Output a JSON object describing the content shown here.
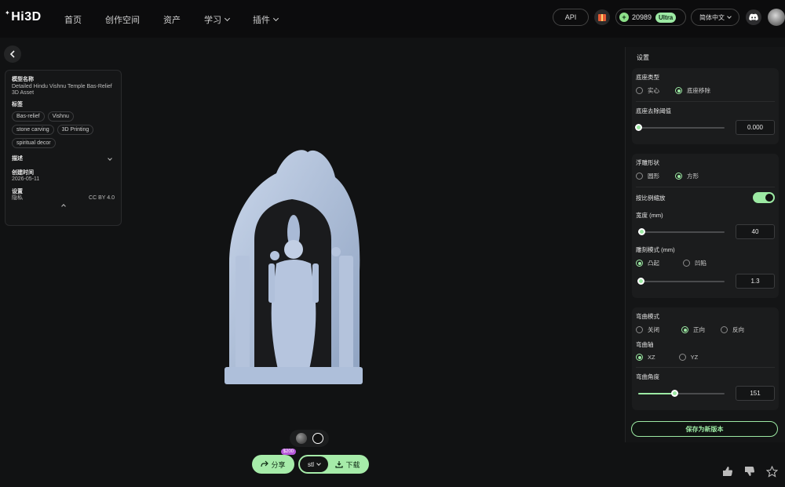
{
  "app": {
    "logo": "Hi3D"
  },
  "nav": [
    {
      "label": "首页",
      "has_dropdown": false
    },
    {
      "label": "创作空间",
      "has_dropdown": false
    },
    {
      "label": "资产",
      "has_dropdown": false
    },
    {
      "label": "学习",
      "has_dropdown": true
    },
    {
      "label": "插件",
      "has_dropdown": true
    }
  ],
  "header": {
    "api_label": "API",
    "credits": "20989",
    "plan": "Ultra",
    "language": "简体中文"
  },
  "model_info": {
    "name_label": "模型名称",
    "name": "Detailed Hindu Vishnu Temple Bas-Relief 3D Asset",
    "tags_label": "标签",
    "tags": [
      "Bas-relief",
      "Vishnu",
      "stone carving",
      "3D Printing",
      "spiritual decor"
    ],
    "desc_label": "描述",
    "created_label": "创建时间",
    "created": "2026-05-11",
    "settings_label": "设置",
    "privacy_label": "隐私",
    "license": "CC BY 4.0"
  },
  "viewer": {
    "share_label": "分享",
    "share_badge": "$200",
    "format": "stl",
    "download_label": "下载"
  },
  "settings": {
    "title": "设置",
    "base_type": {
      "label": "底座类型",
      "options": [
        "实心",
        "底座移除"
      ],
      "selected": 1
    },
    "base_threshold": {
      "label": "底座去除阈值",
      "value": "0.000",
      "fraction": 0.0
    },
    "relief_shape": {
      "label": "浮雕形状",
      "options": [
        "圆形",
        "方形"
      ],
      "selected": 1
    },
    "proportional_scale": {
      "label": "按比例缩放",
      "on": true
    },
    "width": {
      "label": "宽度 (mm)",
      "value": "40",
      "fraction": 0.04
    },
    "carving_mode": {
      "label": "雕刻模式 (mm)",
      "options": [
        "凸起",
        "凹陷"
      ],
      "selected": 0
    },
    "depth": {
      "value": "1.3",
      "fraction": 0.03
    },
    "bend_mode": {
      "label": "弯曲模式",
      "options": [
        "关闭",
        "正向",
        "反向"
      ],
      "selected": 1
    },
    "bend_axis": {
      "label": "弯曲轴",
      "options": [
        "XZ",
        "YZ"
      ],
      "selected": 0
    },
    "bend_angle": {
      "label": "弯曲角度",
      "value": "151",
      "fraction": 0.42
    },
    "save_label": "保存为新版本"
  }
}
